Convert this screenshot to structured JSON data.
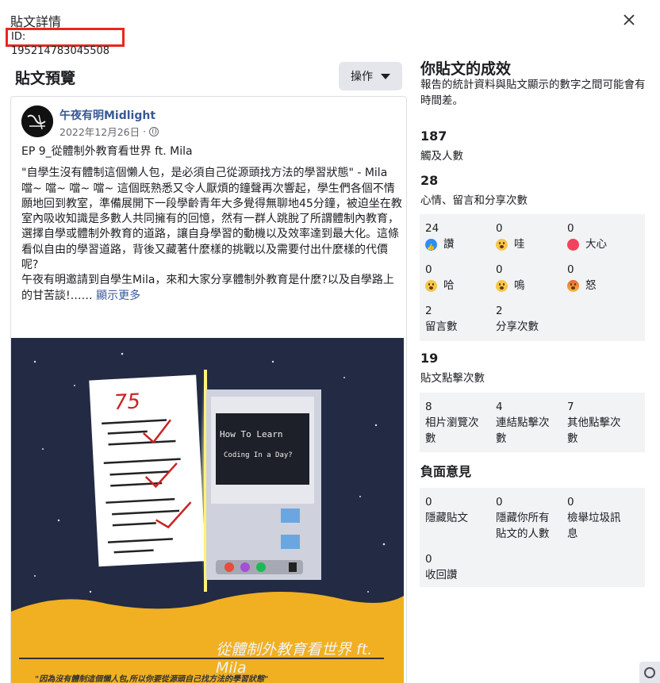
{
  "modal": {
    "title": "貼文詳情",
    "post_id": "ID: 195214783045508",
    "close_icon": "close-icon"
  },
  "preview": {
    "heading": "貼文預覽",
    "action_label": "操作"
  },
  "post": {
    "page_name": "午夜有明Midlight",
    "date": "2022年12月26日",
    "dot": "·",
    "line_title": "EP 9_從體制外教育看世界 ft. Mila",
    "quote": "\"自學生沒有體制這個懶人包，是必須自己從源頭找方法的學習狀態\" - Mila",
    "body": "噹~ 噹~ 噹~ 噹~ 這個既熟悉又令人厭煩的鐘聲再次響起，學生們各個不情願地回到教室，準備展開下一段學齡青年大多覺得無聊地45分鐘，被迫坐在教室內吸收知識是多數人共同擁有的回憶，然有一群人跳脫了所謂體制內教育，選擇自學或體制外教育的道路，讓自身學習的動機以及效率達到最大化。這條看似自由的學習道路，背後又藏著什麼樣的挑戰以及需要付出什麼樣的代價呢?",
    "body_last": "午夜有明邀請到自學生Mila，來和大家分享體制外教育是什麼?以及自學路上的甘苦談!……",
    "see_more": "顯示更多",
    "image": {
      "caption": "從體制外教育看世界 ft. Mila",
      "subcaption": "\"因為沒有體制這個懶人包,所以你要從源頭自己找方法的學習狀態\"",
      "screen_text": "How To Learn Coding In a Day?",
      "paper_score": "75"
    }
  },
  "stats": {
    "title": "你貼文的成效",
    "note": "報告的統計資料與貼文顯示的數字之間可能會有時間差。",
    "reach": {
      "value": "187",
      "label": "觸及人數"
    },
    "engagement": {
      "value": "28",
      "label": "心情、留言和分享次數"
    },
    "reactions": [
      {
        "value": "24",
        "label": "讚",
        "icon": "like-icon"
      },
      {
        "value": "0",
        "label": "哇",
        "icon": "wow-icon"
      },
      {
        "value": "0",
        "label": "大心",
        "icon": "love-icon"
      },
      {
        "value": "0",
        "label": "哈",
        "icon": "haha-icon"
      },
      {
        "value": "0",
        "label": "嗚",
        "icon": "sad-icon"
      },
      {
        "value": "0",
        "label": "怒",
        "icon": "angry-icon"
      }
    ],
    "comments": {
      "value": "2",
      "label": "留言數"
    },
    "shares": {
      "value": "2",
      "label": "分享次數"
    },
    "clicks": {
      "value": "19",
      "label": "貼文點擊次數"
    },
    "click_breakdown": [
      {
        "value": "8",
        "label_1": "相片瀏覽次",
        "label_2": "數"
      },
      {
        "value": "4",
        "label_1": "連結點擊次",
        "label_2": "數"
      },
      {
        "value": "7",
        "label_1": "其他點擊次",
        "label_2": "數"
      }
    ],
    "negative_heading": "負面意見",
    "negative": [
      {
        "value": "0",
        "label_1": "隱藏貼文",
        "label_2": ""
      },
      {
        "value": "0",
        "label_1": "隱藏你所有",
        "label_2": "貼文的人數"
      },
      {
        "value": "0",
        "label_1": "檢舉垃圾訊",
        "label_2": "息"
      },
      {
        "value": "0",
        "label_1": "收回讚",
        "label_2": ""
      }
    ]
  },
  "colors": {
    "highlight_box": "#e8271c",
    "link": "#385898",
    "panel_bg": "#f2f3f5"
  }
}
